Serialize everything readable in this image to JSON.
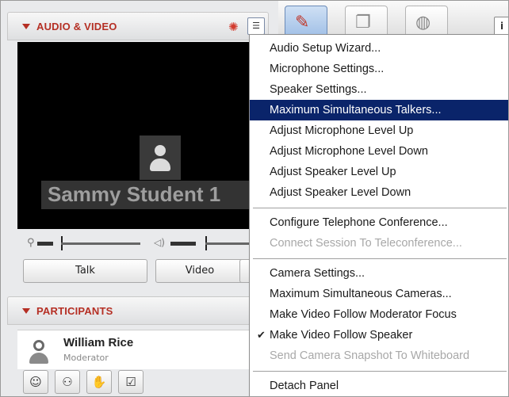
{
  "audio_video_panel": {
    "title": "AUDIO & VIDEO",
    "participant_name_overlay": "Sammy Student 1",
    "talk_label": "Talk",
    "video_label": "Video"
  },
  "participants_panel": {
    "title": "PARTICIPANTS",
    "participant": {
      "name": "William Rice",
      "role": "Moderator"
    }
  },
  "menu": {
    "items": [
      {
        "label": "Audio Setup Wizard...",
        "enabled": true
      },
      {
        "label": "Microphone Settings...",
        "enabled": true
      },
      {
        "label": "Speaker Settings...",
        "enabled": true
      },
      {
        "label": "Maximum Simultaneous Talkers...",
        "enabled": true,
        "highlighted": true
      },
      {
        "label": "Adjust Microphone Level Up",
        "enabled": true
      },
      {
        "label": "Adjust Microphone Level Down",
        "enabled": true
      },
      {
        "label": "Adjust Speaker Level Up",
        "enabled": true
      },
      {
        "label": "Adjust Speaker Level Down",
        "enabled": true
      },
      {
        "label": "Configure Telephone Conference...",
        "enabled": true
      },
      {
        "label": "Connect Session To Teleconference...",
        "enabled": false
      },
      {
        "label": "Camera Settings...",
        "enabled": true
      },
      {
        "label": "Maximum Simultaneous Cameras...",
        "enabled": true
      },
      {
        "label": "Make Video Follow Moderator Focus",
        "enabled": true
      },
      {
        "label": "Make Video Follow Speaker",
        "enabled": true,
        "checked": true
      },
      {
        "label": "Send Camera Snapshot To Whiteboard",
        "enabled": false
      },
      {
        "label": "Detach Panel",
        "enabled": true
      }
    ],
    "highlight_color": "#0a246a"
  },
  "icons": {
    "panel_collapse": "triangle-down-icon",
    "options": "menu-options-icon",
    "participant": "user-icon"
  }
}
